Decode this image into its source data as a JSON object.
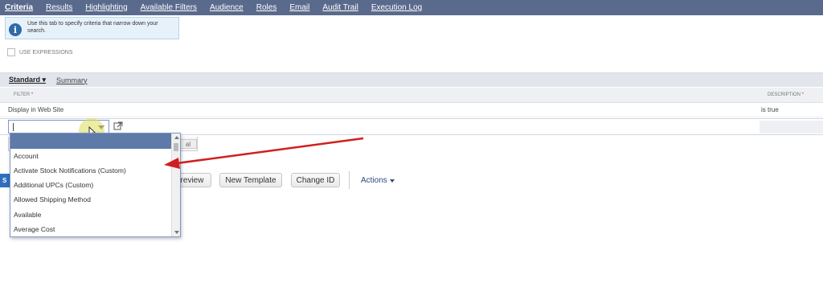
{
  "tabs": [
    {
      "label": "Criteria"
    },
    {
      "label": "Results"
    },
    {
      "label": "Highlighting"
    },
    {
      "label": "Available Filters"
    },
    {
      "label": "Audience"
    },
    {
      "label": "Roles"
    },
    {
      "label": "Email"
    },
    {
      "label": "Audit Trail"
    },
    {
      "label": "Execution Log"
    }
  ],
  "info": {
    "text": "Use this tab to specify criteria that narrow down your search."
  },
  "use_expressions": {
    "label": "USE EXPRESSIONS",
    "checked": false
  },
  "subtabs": {
    "standard": "Standard",
    "summary": "Summary"
  },
  "grid": {
    "filter_header": "FILTER",
    "description_header": "DESCRIPTION",
    "row": {
      "filter": "Display in Web Site",
      "description": "is true"
    }
  },
  "dropdown": {
    "items": [
      "Account",
      "Activate Stock Notifications (Custom)",
      "Additional UPCs (Custom)",
      "Allowed Shipping Method",
      "Available",
      "Average Cost"
    ]
  },
  "under_button_fragment": "al",
  "buttons": {
    "edge": "S",
    "preview": "review",
    "new_template": "New Template",
    "change_id": "Change ID",
    "actions": "Actions"
  },
  "colors": {
    "nav": "#5a6a8c",
    "accent_blue": "#2e6fbd",
    "arrow_red": "#d11f1f",
    "highlight": "#dcdc5a"
  }
}
